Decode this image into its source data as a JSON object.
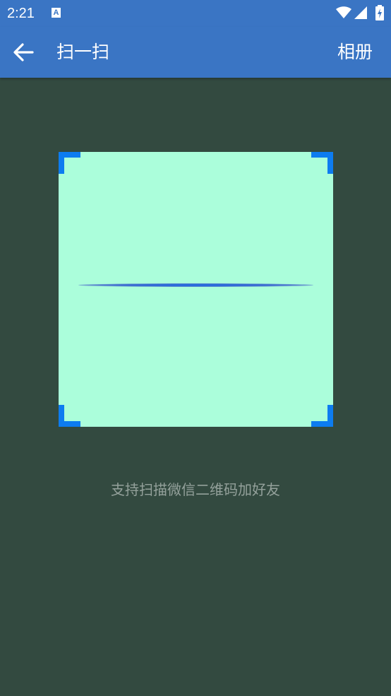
{
  "status_bar": {
    "time": "2:21",
    "notification_icon_letter": "A",
    "icons": [
      "wifi-icon",
      "signal-icon",
      "battery-charging-icon"
    ]
  },
  "app_bar": {
    "back_icon": "arrow-left-icon",
    "title": "扫一扫",
    "album_label": "相册",
    "color": "#3a75c4"
  },
  "scanner": {
    "frame_color": "#abfedb",
    "corner_color": "#0d7cf0",
    "hint": "支持扫描微信二维码加好友"
  },
  "background_color": "#334a40"
}
